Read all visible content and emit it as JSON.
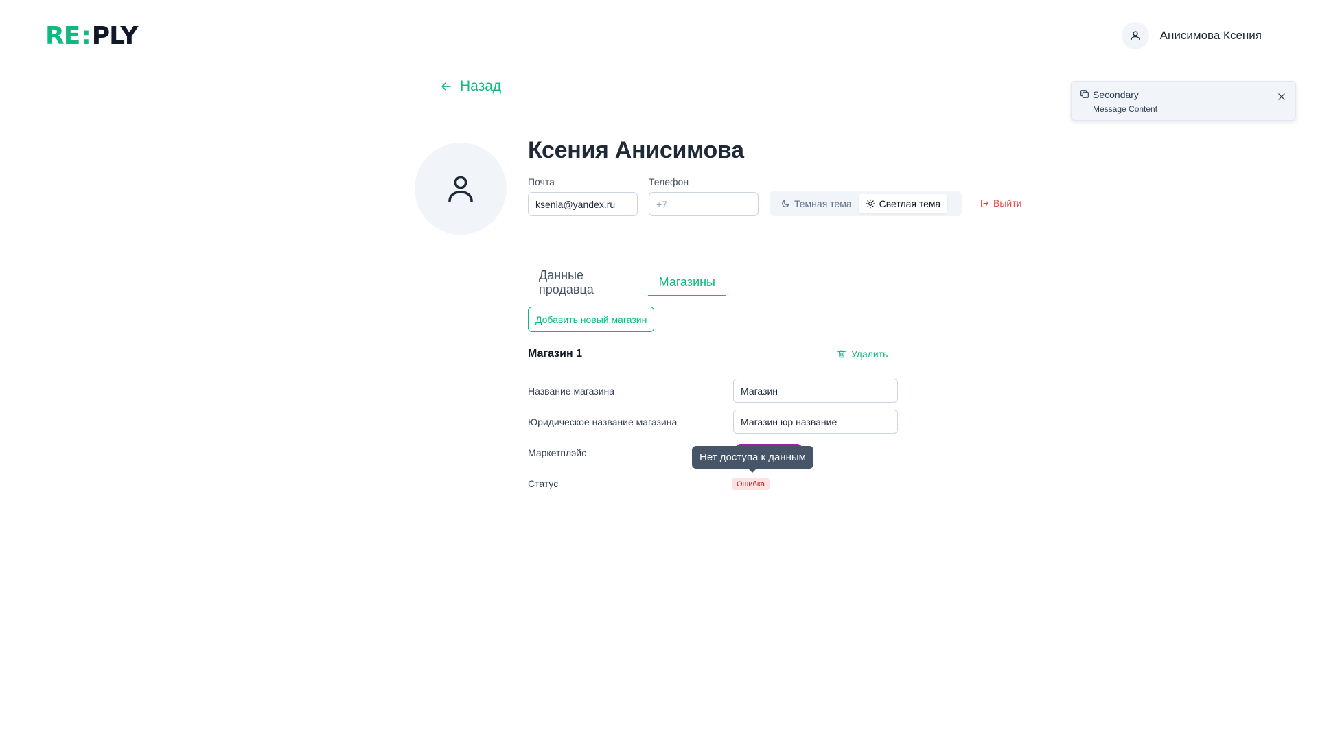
{
  "header": {
    "logo": {
      "part1": "RE",
      "part2": ":",
      "part3": "PLY"
    },
    "user_name": "Анисимова Ксения",
    "user_icon": "user-icon"
  },
  "toast": {
    "icon": "copy-icon",
    "title": "Secondary",
    "message": "Message Content",
    "close_icon": "close-icon"
  },
  "back": {
    "label": "Назад",
    "icon": "arrow-left-icon"
  },
  "profile": {
    "name": "Ксения Анисимова",
    "avatar_icon": "user-icon",
    "email": {
      "label": "Почта",
      "value": "ksenia@yandex.ru"
    },
    "phone": {
      "label": "Телефон",
      "placeholder": "+7"
    },
    "theme": {
      "dark_label": "Темная тема",
      "dark_icon": "moon-icon",
      "light_label": "Светлая тема",
      "light_icon": "sun-icon",
      "selected": "light"
    },
    "logout": {
      "label": "Выйти",
      "icon": "logout-icon"
    }
  },
  "tabs": [
    {
      "label": "Данные продавца",
      "active": false
    },
    {
      "label": "Магазины",
      "active": true
    }
  ],
  "stores": {
    "add_button": "Добавить новый магазин",
    "store": {
      "title": "Магазин 1",
      "delete_label": "Удалить",
      "delete_icon": "trash-icon",
      "fields": {
        "name": {
          "label": "Название магазина",
          "value": "Магазин"
        },
        "legal_name": {
          "label": "Юридическое название магазина",
          "value": "Магазин юр название"
        },
        "marketplace": {
          "label": "Маркетплэйс",
          "badge_color": "#a21caf"
        },
        "status": {
          "label": "Статус",
          "value": "Ошибка"
        }
      }
    },
    "tooltip": "Нет доступа к данным"
  },
  "colors": {
    "accent": "#10b981",
    "danger": "#ef4444",
    "error_badge_bg": "#fee2e2",
    "tooltip_bg": "#475569"
  }
}
